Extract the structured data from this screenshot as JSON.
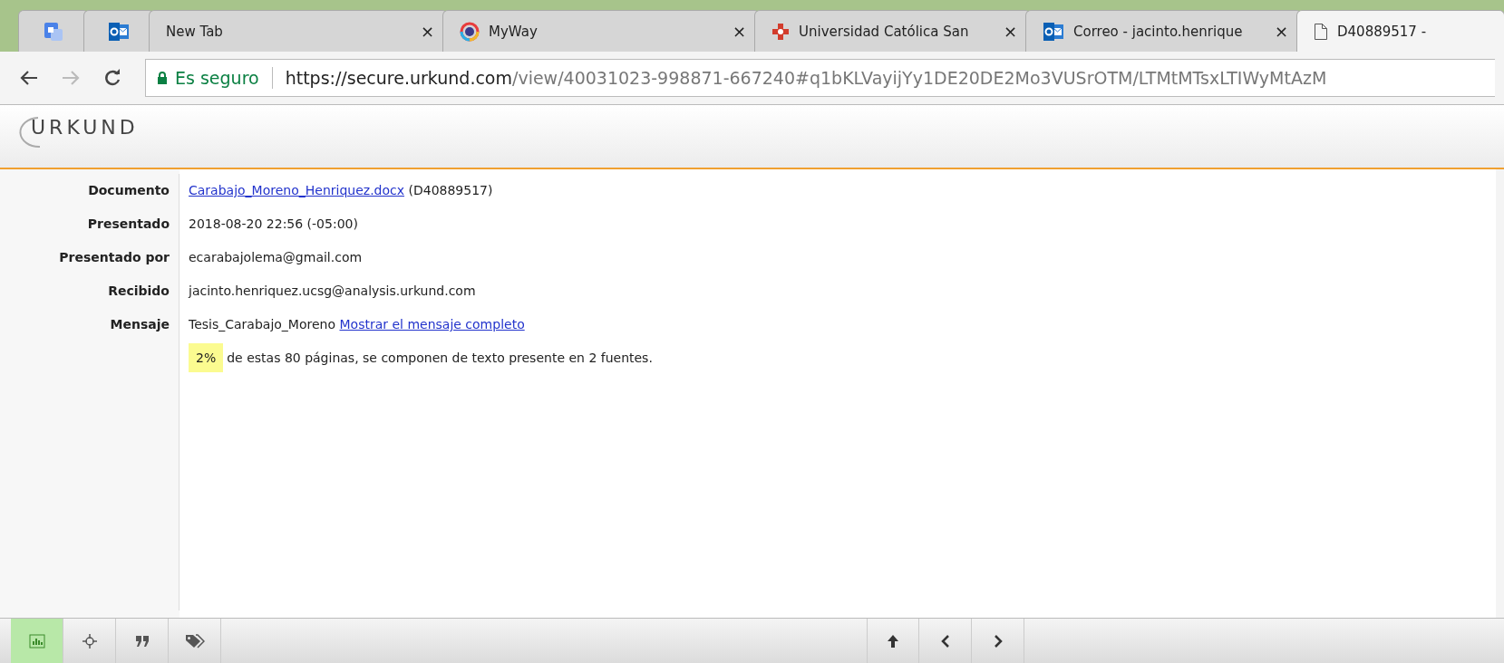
{
  "tabs": [
    {
      "kind": "pinned",
      "selected": false
    },
    {
      "kind": "pinned",
      "selected": false
    },
    {
      "kind": "normal",
      "title": "New Tab",
      "close": "×",
      "selected": false
    },
    {
      "kind": "normal",
      "title": "MyWay",
      "close": "×",
      "selected": false
    },
    {
      "kind": "normal",
      "title": "Universidad Católica San",
      "close": "×",
      "selected": false
    },
    {
      "kind": "normal",
      "title": "Correo - jacinto.henrique",
      "close": "×",
      "selected": false
    },
    {
      "kind": "normal",
      "title": "D40889517 -",
      "selected": true
    }
  ],
  "toolbar": {
    "security": "Es seguro",
    "url_host": "https://secure.urkund.com",
    "url_path": "/view/40031023-998871-667240#q1bKLVayijYy1DE20DE2Mo3VUSrOTM/LTMtMTsxLTIWyMtAzM"
  },
  "header": {
    "logo": "URKUND"
  },
  "details": [
    {
      "label": "Documento",
      "value": "Carabajo_Moreno_Henriquez.docx",
      "kind": "link",
      "suffix": "(D40889517)"
    },
    {
      "label": "Presentado",
      "value": "2018-08-20 22:56 (-05:00)",
      "kind": "text"
    },
    {
      "label": "Presentado por",
      "value": "ecarabajolema@gmail.com",
      "kind": "text"
    },
    {
      "label": "Recibido",
      "value": "jacinto.henriquez.ucsg@analysis.urkund.com",
      "kind": "text"
    },
    {
      "label": "Mensaje",
      "value": "Tesis_Carabajo_Moreno",
      "kind": "text",
      "suffix_link": "Mostrar el mensaje completo"
    }
  ],
  "summary": {
    "percent": "2%",
    "text": "de estas 80 páginas, se componen de texto presente en 2 fuentes."
  },
  "bottom_bar": {
    "left": [
      {
        "selected": true
      },
      {
        "selected": false
      },
      {
        "selected": false
      },
      {
        "selected": false
      }
    ],
    "right": [
      {
        "selected": false
      },
      {
        "selected": false
      },
      {
        "selected": false
      }
    ]
  }
}
